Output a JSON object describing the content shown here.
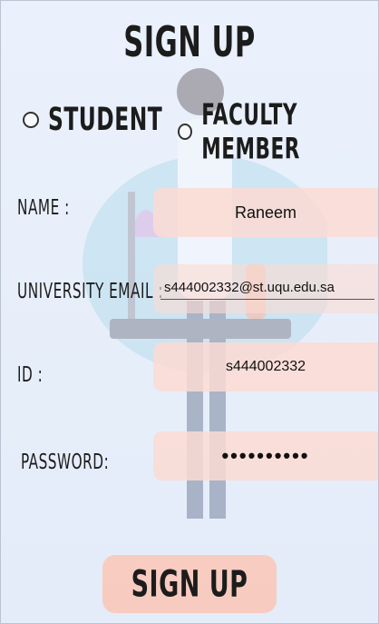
{
  "title": "SIGN UP",
  "roles": [
    {
      "label": "STUDENT",
      "selected": false
    },
    {
      "label": "FACULTY MEMBER",
      "selected": false
    }
  ],
  "form": {
    "name_label": "NAME :",
    "name_value": "Raneem",
    "email_label": "UNIVERSITY EMAIL :",
    "email_value": "s444002332@st.uqu.edu.sa",
    "id_label": "ID :",
    "id_value": "s444002332",
    "password_label": "PASSWORD:",
    "password_value": "••••••••••"
  },
  "submit_label": "SIGN UP",
  "colors": {
    "background": "#e6eefa",
    "field_fill": "#fcdad2",
    "button_fill": "#fac8b9"
  }
}
